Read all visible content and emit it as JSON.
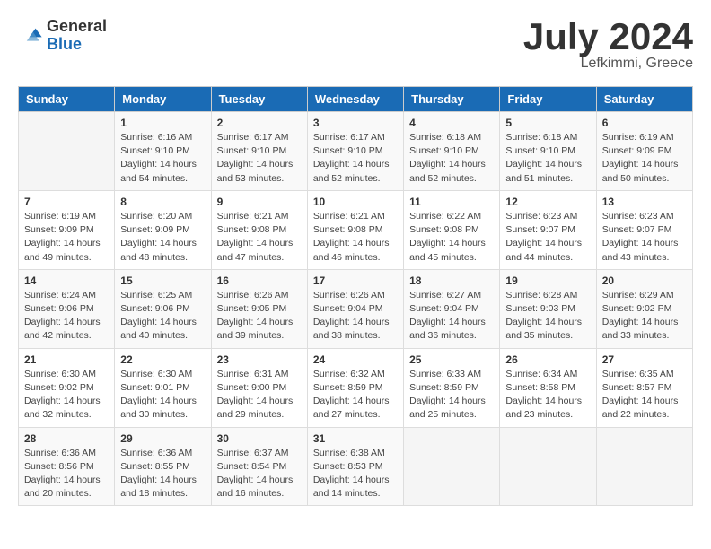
{
  "logo": {
    "general": "General",
    "blue": "Blue"
  },
  "title": "July 2024",
  "location": "Lefkimmi, Greece",
  "days_header": [
    "Sunday",
    "Monday",
    "Tuesday",
    "Wednesday",
    "Thursday",
    "Friday",
    "Saturday"
  ],
  "weeks": [
    [
      {
        "day": "",
        "sunrise": "",
        "sunset": "",
        "daylight": ""
      },
      {
        "day": "1",
        "sunrise": "Sunrise: 6:16 AM",
        "sunset": "Sunset: 9:10 PM",
        "daylight": "Daylight: 14 hours and 54 minutes."
      },
      {
        "day": "2",
        "sunrise": "Sunrise: 6:17 AM",
        "sunset": "Sunset: 9:10 PM",
        "daylight": "Daylight: 14 hours and 53 minutes."
      },
      {
        "day": "3",
        "sunrise": "Sunrise: 6:17 AM",
        "sunset": "Sunset: 9:10 PM",
        "daylight": "Daylight: 14 hours and 52 minutes."
      },
      {
        "day": "4",
        "sunrise": "Sunrise: 6:18 AM",
        "sunset": "Sunset: 9:10 PM",
        "daylight": "Daylight: 14 hours and 52 minutes."
      },
      {
        "day": "5",
        "sunrise": "Sunrise: 6:18 AM",
        "sunset": "Sunset: 9:10 PM",
        "daylight": "Daylight: 14 hours and 51 minutes."
      },
      {
        "day": "6",
        "sunrise": "Sunrise: 6:19 AM",
        "sunset": "Sunset: 9:09 PM",
        "daylight": "Daylight: 14 hours and 50 minutes."
      }
    ],
    [
      {
        "day": "7",
        "sunrise": "Sunrise: 6:19 AM",
        "sunset": "Sunset: 9:09 PM",
        "daylight": "Daylight: 14 hours and 49 minutes."
      },
      {
        "day": "8",
        "sunrise": "Sunrise: 6:20 AM",
        "sunset": "Sunset: 9:09 PM",
        "daylight": "Daylight: 14 hours and 48 minutes."
      },
      {
        "day": "9",
        "sunrise": "Sunrise: 6:21 AM",
        "sunset": "Sunset: 9:08 PM",
        "daylight": "Daylight: 14 hours and 47 minutes."
      },
      {
        "day": "10",
        "sunrise": "Sunrise: 6:21 AM",
        "sunset": "Sunset: 9:08 PM",
        "daylight": "Daylight: 14 hours and 46 minutes."
      },
      {
        "day": "11",
        "sunrise": "Sunrise: 6:22 AM",
        "sunset": "Sunset: 9:08 PM",
        "daylight": "Daylight: 14 hours and 45 minutes."
      },
      {
        "day": "12",
        "sunrise": "Sunrise: 6:23 AM",
        "sunset": "Sunset: 9:07 PM",
        "daylight": "Daylight: 14 hours and 44 minutes."
      },
      {
        "day": "13",
        "sunrise": "Sunrise: 6:23 AM",
        "sunset": "Sunset: 9:07 PM",
        "daylight": "Daylight: 14 hours and 43 minutes."
      }
    ],
    [
      {
        "day": "14",
        "sunrise": "Sunrise: 6:24 AM",
        "sunset": "Sunset: 9:06 PM",
        "daylight": "Daylight: 14 hours and 42 minutes."
      },
      {
        "day": "15",
        "sunrise": "Sunrise: 6:25 AM",
        "sunset": "Sunset: 9:06 PM",
        "daylight": "Daylight: 14 hours and 40 minutes."
      },
      {
        "day": "16",
        "sunrise": "Sunrise: 6:26 AM",
        "sunset": "Sunset: 9:05 PM",
        "daylight": "Daylight: 14 hours and 39 minutes."
      },
      {
        "day": "17",
        "sunrise": "Sunrise: 6:26 AM",
        "sunset": "Sunset: 9:04 PM",
        "daylight": "Daylight: 14 hours and 38 minutes."
      },
      {
        "day": "18",
        "sunrise": "Sunrise: 6:27 AM",
        "sunset": "Sunset: 9:04 PM",
        "daylight": "Daylight: 14 hours and 36 minutes."
      },
      {
        "day": "19",
        "sunrise": "Sunrise: 6:28 AM",
        "sunset": "Sunset: 9:03 PM",
        "daylight": "Daylight: 14 hours and 35 minutes."
      },
      {
        "day": "20",
        "sunrise": "Sunrise: 6:29 AM",
        "sunset": "Sunset: 9:02 PM",
        "daylight": "Daylight: 14 hours and 33 minutes."
      }
    ],
    [
      {
        "day": "21",
        "sunrise": "Sunrise: 6:30 AM",
        "sunset": "Sunset: 9:02 PM",
        "daylight": "Daylight: 14 hours and 32 minutes."
      },
      {
        "day": "22",
        "sunrise": "Sunrise: 6:30 AM",
        "sunset": "Sunset: 9:01 PM",
        "daylight": "Daylight: 14 hours and 30 minutes."
      },
      {
        "day": "23",
        "sunrise": "Sunrise: 6:31 AM",
        "sunset": "Sunset: 9:00 PM",
        "daylight": "Daylight: 14 hours and 29 minutes."
      },
      {
        "day": "24",
        "sunrise": "Sunrise: 6:32 AM",
        "sunset": "Sunset: 8:59 PM",
        "daylight": "Daylight: 14 hours and 27 minutes."
      },
      {
        "day": "25",
        "sunrise": "Sunrise: 6:33 AM",
        "sunset": "Sunset: 8:59 PM",
        "daylight": "Daylight: 14 hours and 25 minutes."
      },
      {
        "day": "26",
        "sunrise": "Sunrise: 6:34 AM",
        "sunset": "Sunset: 8:58 PM",
        "daylight": "Daylight: 14 hours and 23 minutes."
      },
      {
        "day": "27",
        "sunrise": "Sunrise: 6:35 AM",
        "sunset": "Sunset: 8:57 PM",
        "daylight": "Daylight: 14 hours and 22 minutes."
      }
    ],
    [
      {
        "day": "28",
        "sunrise": "Sunrise: 6:36 AM",
        "sunset": "Sunset: 8:56 PM",
        "daylight": "Daylight: 14 hours and 20 minutes."
      },
      {
        "day": "29",
        "sunrise": "Sunrise: 6:36 AM",
        "sunset": "Sunset: 8:55 PM",
        "daylight": "Daylight: 14 hours and 18 minutes."
      },
      {
        "day": "30",
        "sunrise": "Sunrise: 6:37 AM",
        "sunset": "Sunset: 8:54 PM",
        "daylight": "Daylight: 14 hours and 16 minutes."
      },
      {
        "day": "31",
        "sunrise": "Sunrise: 6:38 AM",
        "sunset": "Sunset: 8:53 PM",
        "daylight": "Daylight: 14 hours and 14 minutes."
      },
      {
        "day": "",
        "sunrise": "",
        "sunset": "",
        "daylight": ""
      },
      {
        "day": "",
        "sunrise": "",
        "sunset": "",
        "daylight": ""
      },
      {
        "day": "",
        "sunrise": "",
        "sunset": "",
        "daylight": ""
      }
    ]
  ]
}
